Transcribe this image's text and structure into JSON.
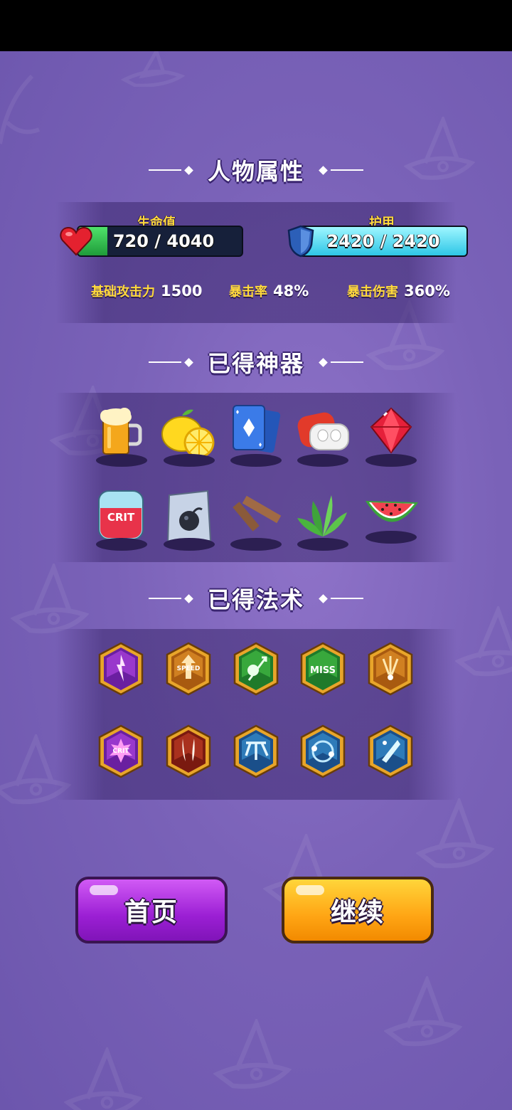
{
  "sections": {
    "attributes_title": "人物属性",
    "artifacts_title": "已得神器",
    "spells_title": "已得法术"
  },
  "health": {
    "label": "生命值",
    "value": "720 / 4040",
    "fraction": 0.178
  },
  "armor": {
    "label": "护甲",
    "value": "2420 / 2420",
    "fraction": 1.0
  },
  "stats": {
    "attack": {
      "label": "基础攻击力",
      "value": "1500"
    },
    "crit_rate": {
      "label": "暴击率",
      "value": "48%"
    },
    "crit_damage": {
      "label": "暴击伤害",
      "value": "360%"
    }
  },
  "artifacts": [
    {
      "name": "beer-mug-icon"
    },
    {
      "name": "lemon-icon"
    },
    {
      "name": "playing-cards-icon"
    },
    {
      "name": "earbuds-icon"
    },
    {
      "name": "red-gem-icon"
    },
    {
      "name": "crit-blood-bag-icon",
      "text": "CRIT"
    },
    {
      "name": "bomb-bag-icon"
    },
    {
      "name": "wood-planks-icon"
    },
    {
      "name": "green-leaves-icon"
    },
    {
      "name": "watermelon-icon"
    }
  ],
  "spells": [
    {
      "name": "purple-bolt-spell-icon",
      "frame": "purple"
    },
    {
      "name": "speed-up-spell-icon",
      "frame": "orange",
      "text": "SPEED"
    },
    {
      "name": "skull-arrow-spell-icon",
      "frame": "green"
    },
    {
      "name": "miss-spell-icon",
      "frame": "green",
      "text": "MISS"
    },
    {
      "name": "triple-shot-spell-icon",
      "frame": "orange"
    },
    {
      "name": "crit-burst-spell-icon",
      "frame": "purple",
      "text": "CRIT"
    },
    {
      "name": "double-fang-spell-icon",
      "frame": "red"
    },
    {
      "name": "split-arrow-spell-icon",
      "frame": "blue"
    },
    {
      "name": "orbit-spell-icon",
      "frame": "blue"
    },
    {
      "name": "ice-shard-spell-icon",
      "frame": "blue"
    }
  ],
  "buttons": {
    "home": "首页",
    "continue": "继续"
  },
  "colors": {
    "accent_yellow": "#ffd93b",
    "health_green": "#2fc04d",
    "armor_cyan": "#5fe3f5",
    "home_purple": "#b52ee6",
    "continue_orange": "#ffb21a"
  }
}
